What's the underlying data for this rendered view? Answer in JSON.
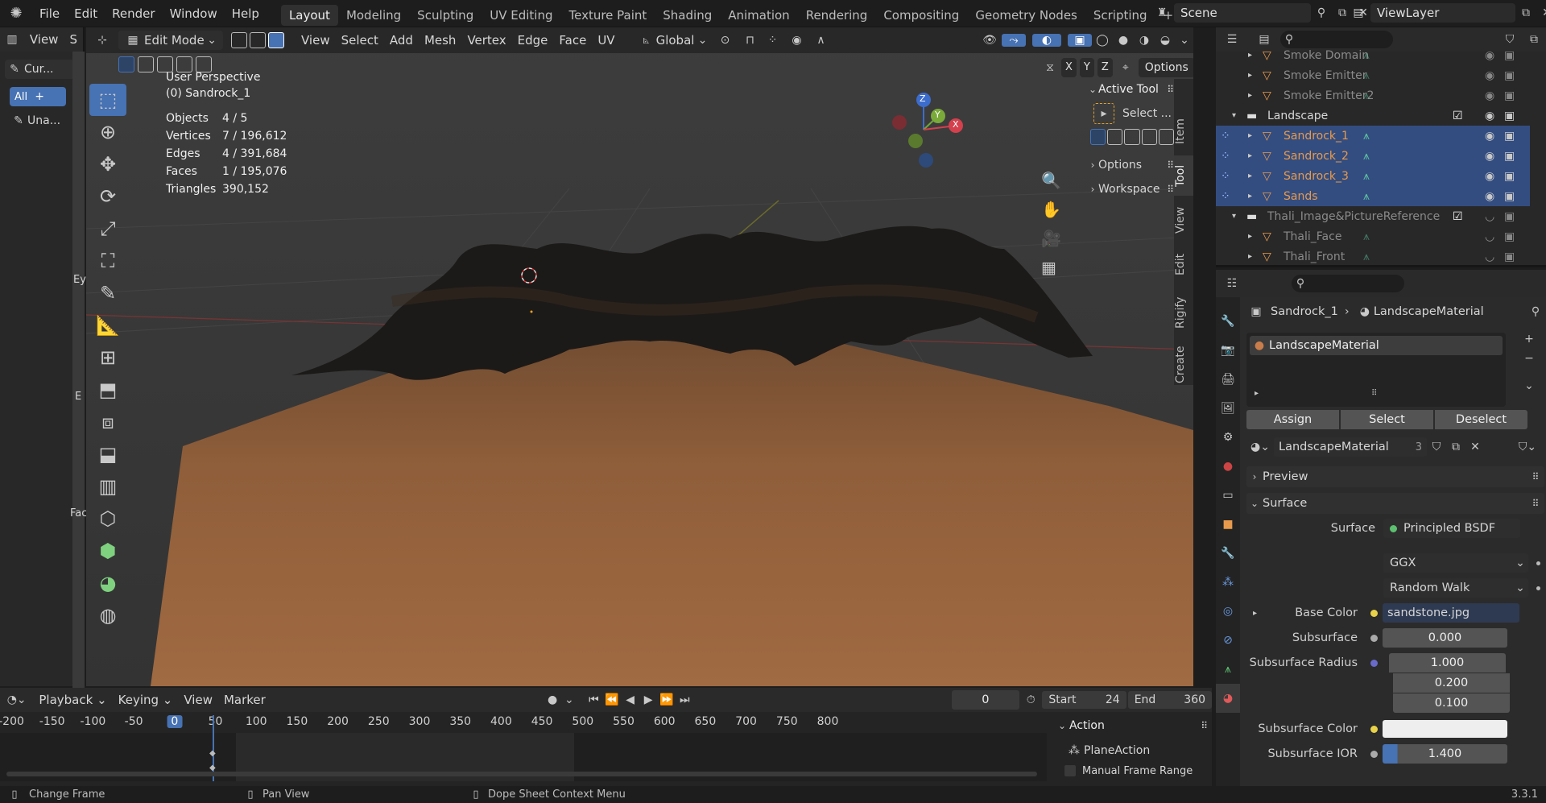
{
  "app": {
    "version": "3.3.1"
  },
  "menu": {
    "items": [
      "File",
      "Edit",
      "Render",
      "Window",
      "Help"
    ]
  },
  "workspaces": {
    "active": "Layout",
    "tabs": [
      "Modeling",
      "Sculpting",
      "UV Editing",
      "Texture Paint",
      "Shading",
      "Animation",
      "Rendering",
      "Compositing",
      "Geometry Nodes",
      "Scripting"
    ],
    "add": "+"
  },
  "scene": {
    "label": "Scene",
    "view_layer": "ViewLayer"
  },
  "left_editor": {
    "view": "View",
    "s_trunc": "S",
    "cur_label": "Cur...",
    "all_label": "All",
    "una_label": "Una...",
    "side_letters": [
      "Ey",
      "E",
      "Fac"
    ]
  },
  "viewport_header": {
    "mode": "Edit Mode",
    "view": "View",
    "select": "Select",
    "add": "Add",
    "mesh": "Mesh",
    "vertex": "Vertex",
    "edge": "Edge",
    "face": "Face",
    "uv": "UV",
    "orientation": "Global",
    "x": "X",
    "y": "Y",
    "z": "Z",
    "options": "Options"
  },
  "viewport": {
    "perspective": "User Perspective",
    "object": "(0) Sandrock_1",
    "stats": [
      {
        "label": "Objects",
        "value": "4 / 5"
      },
      {
        "label": "Vertices",
        "value": "7 / 196,612"
      },
      {
        "label": "Edges",
        "value": "4 / 391,684"
      },
      {
        "label": "Faces",
        "value": "1 / 195,076"
      },
      {
        "label": "Triangles",
        "value": "390,152"
      }
    ],
    "gizmo": {
      "z": "Z",
      "y": "Y",
      "x": "X"
    }
  },
  "n_panel": {
    "active_tool": "Active Tool",
    "select_label": "Select ...",
    "options": "Options",
    "workspace": "Workspace",
    "tabs": [
      "Item",
      "Tool",
      "View",
      "Edit",
      "Rigify",
      "Create"
    ]
  },
  "outliner": {
    "rows": [
      {
        "name": "Smoke Domain",
        "indent": 1,
        "dim": true,
        "sel": false
      },
      {
        "name": "Smoke Emitter",
        "indent": 1,
        "dim": true,
        "sel": false
      },
      {
        "name": "Smoke Emitter2",
        "indent": 1,
        "dim": true,
        "sel": false
      },
      {
        "name": "Landscape",
        "indent": 0,
        "dim": false,
        "sel": false,
        "collection": true
      },
      {
        "name": "Sandrock_1",
        "indent": 1,
        "dim": false,
        "sel": true,
        "orange": true
      },
      {
        "name": "Sandrock_2",
        "indent": 1,
        "dim": false,
        "sel": true,
        "orange": true
      },
      {
        "name": "Sandrock_3",
        "indent": 1,
        "dim": false,
        "sel": true,
        "orange": true
      },
      {
        "name": "Sands",
        "indent": 1,
        "dim": false,
        "sel": true,
        "orange": true
      },
      {
        "name": "Thali_Image&PictureReference",
        "indent": 0,
        "dim": true,
        "sel": false,
        "collection": true
      },
      {
        "name": "Thali_Face",
        "indent": 1,
        "dim": true,
        "sel": false
      },
      {
        "name": "Thali_Front",
        "indent": 1,
        "dim": true,
        "sel": false
      }
    ]
  },
  "properties": {
    "breadcrumb_object": "Sandrock_1",
    "breadcrumb_material": "LandscapeMaterial",
    "slot": "LandscapeMaterial",
    "assign": "Assign",
    "select": "Select",
    "deselect": "Deselect",
    "material_name": "LandscapeMaterial",
    "users": "3",
    "preview": "Preview",
    "surface_section": "Surface",
    "surface_label": "Surface",
    "surface_value": "Principled BSDF",
    "distribution": "GGX",
    "subsurface_method": "Random Walk",
    "base_color_label": "Base Color",
    "base_color_value": "sandstone.jpg",
    "subsurface_label": "Subsurface",
    "subsurface_value": "0.000",
    "subsurface_radius_label": "Subsurface Radius",
    "radius": [
      "1.000",
      "0.200",
      "0.100"
    ],
    "subsurface_color_label": "Subsurface Color",
    "subsurface_ior_label": "Subsurface IOR",
    "subsurface_ior_value": "1.400"
  },
  "timeline": {
    "playback": "Playback",
    "keying": "Keying",
    "view": "View",
    "marker": "Marker",
    "current": "0",
    "start_label": "Start",
    "start": "24",
    "end_label": "End",
    "end": "360",
    "ticks": [
      "-200",
      "-150",
      "-100",
      "-50",
      "0",
      "50",
      "100",
      "150",
      "200",
      "250",
      "300",
      "350",
      "400",
      "450",
      "500",
      "550",
      "600",
      "650",
      "700",
      "750",
      "800"
    ],
    "action_header": "Action",
    "action_name": "PlaneAction",
    "manual_range": "Manual Frame Range"
  },
  "statusbar": {
    "change_frame": "Change Frame",
    "pan_view": "Pan View",
    "context_menu": "Dope Sheet Context Menu"
  },
  "colors": {
    "accent": "#4772b3",
    "selected_row": "#334d80",
    "orange_text": "#e89a4c",
    "ground": "#8f5e3a"
  }
}
